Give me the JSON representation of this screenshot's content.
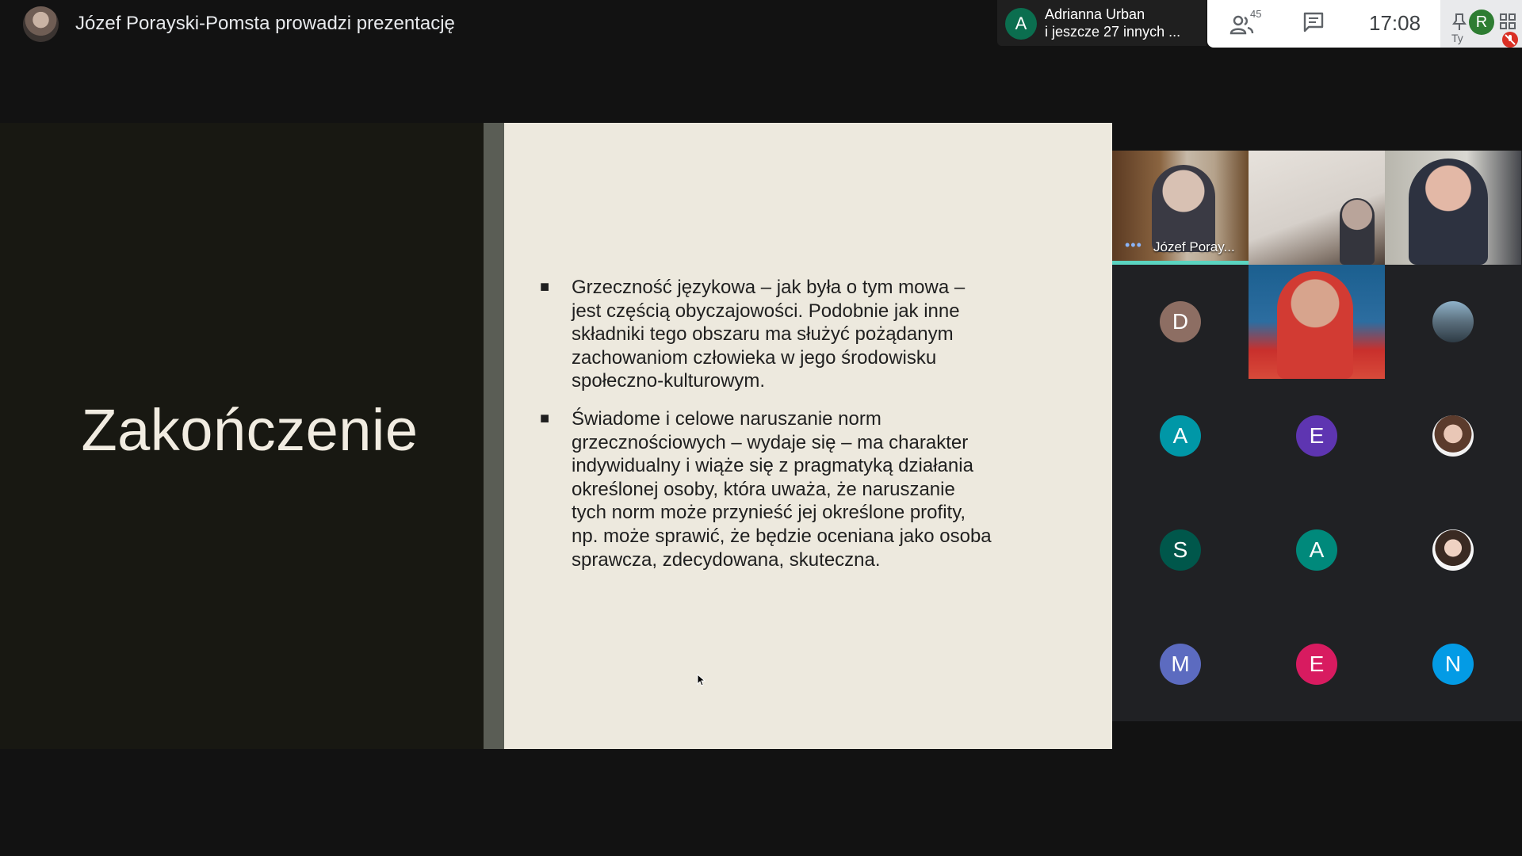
{
  "header": {
    "presenter_title": "Józef Porayski-Pomsta prowadzi prezentację",
    "raised": {
      "avatar_letter": "A",
      "line1": "Adrianna Urban",
      "line2": "i jeszcze 27 innych ..."
    },
    "people_count": "45",
    "clock": "17:08",
    "self": {
      "avatar_letter": "R",
      "label": "Ty"
    }
  },
  "slide": {
    "title": "Zakończenie",
    "bullets": [
      "Grzeczność językowa – jak była o tym mowa – jest częścią obyczajowości. Podobnie jak inne składniki tego obszaru ma służyć pożądanym zachowaniom człowieka w jego środowisku społeczno-kulturowym.",
      "Świadome i celowe naruszanie norm grzecznościowych – wydaje się – ma charakter indywidualny i wiąże się z pragmatyką działania określonej osoby, która uważa, że naruszanie tych norm może przynieść jej określone profity, np. może sprawić, że będzie oceniana jako osoba sprawcza, zdecydowana, skuteczna."
    ],
    "bullet_mark": "■"
  },
  "participants": {
    "presenter_name": "Józef Poray...",
    "avatars": [
      {
        "letter": "D",
        "color": "#8d6e63"
      },
      {
        "letter": "A",
        "color": "#0097a7"
      },
      {
        "letter": "E",
        "color": "#5e35b1"
      },
      {
        "letter": "S",
        "color": "#00574b"
      },
      {
        "letter": "A",
        "color": "#00897b"
      },
      {
        "letter": "M",
        "color": "#5c6bc0"
      },
      {
        "letter": "E",
        "color": "#d81b60"
      },
      {
        "letter": "N",
        "color": "#039be5"
      }
    ]
  },
  "icons": [
    "people-icon",
    "chat-icon",
    "pin-icon",
    "grid-icon",
    "mic-off-icon",
    "more-dots-icon",
    "cursor-icon"
  ]
}
